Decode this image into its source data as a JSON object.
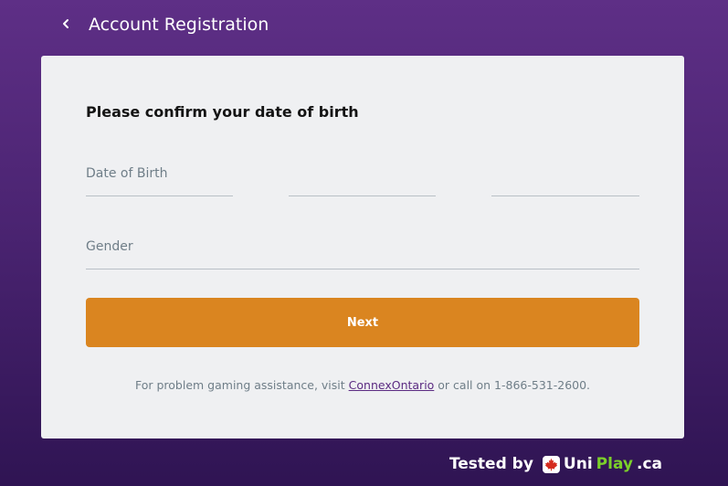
{
  "header": {
    "back_icon": "chevron-left-icon",
    "title": "Account Registration"
  },
  "form": {
    "heading": "Please confirm your date of birth",
    "date_of_birth_label": "Date of Birth",
    "gender_label": "Gender",
    "next_label": "Next"
  },
  "footer": {
    "before_link": "For problem gaming assistance, visit ",
    "link_text": "ConnexOntario",
    "after_link": " or call on 1-866-531-2600."
  },
  "watermark": {
    "tested_by": "Tested by",
    "logo_uni": "Uni",
    "logo_play": "Play",
    "logo_ca": ".ca",
    "flag_icon": "maple-leaf-icon"
  },
  "colors": {
    "background_top": "#5e2f86",
    "background_bottom": "#2f1453",
    "card": "#eff0f2",
    "button": "#da8520",
    "link": "#5b2b82",
    "brand_green": "#7bcf2a",
    "flag_red": "#d52b1e"
  }
}
